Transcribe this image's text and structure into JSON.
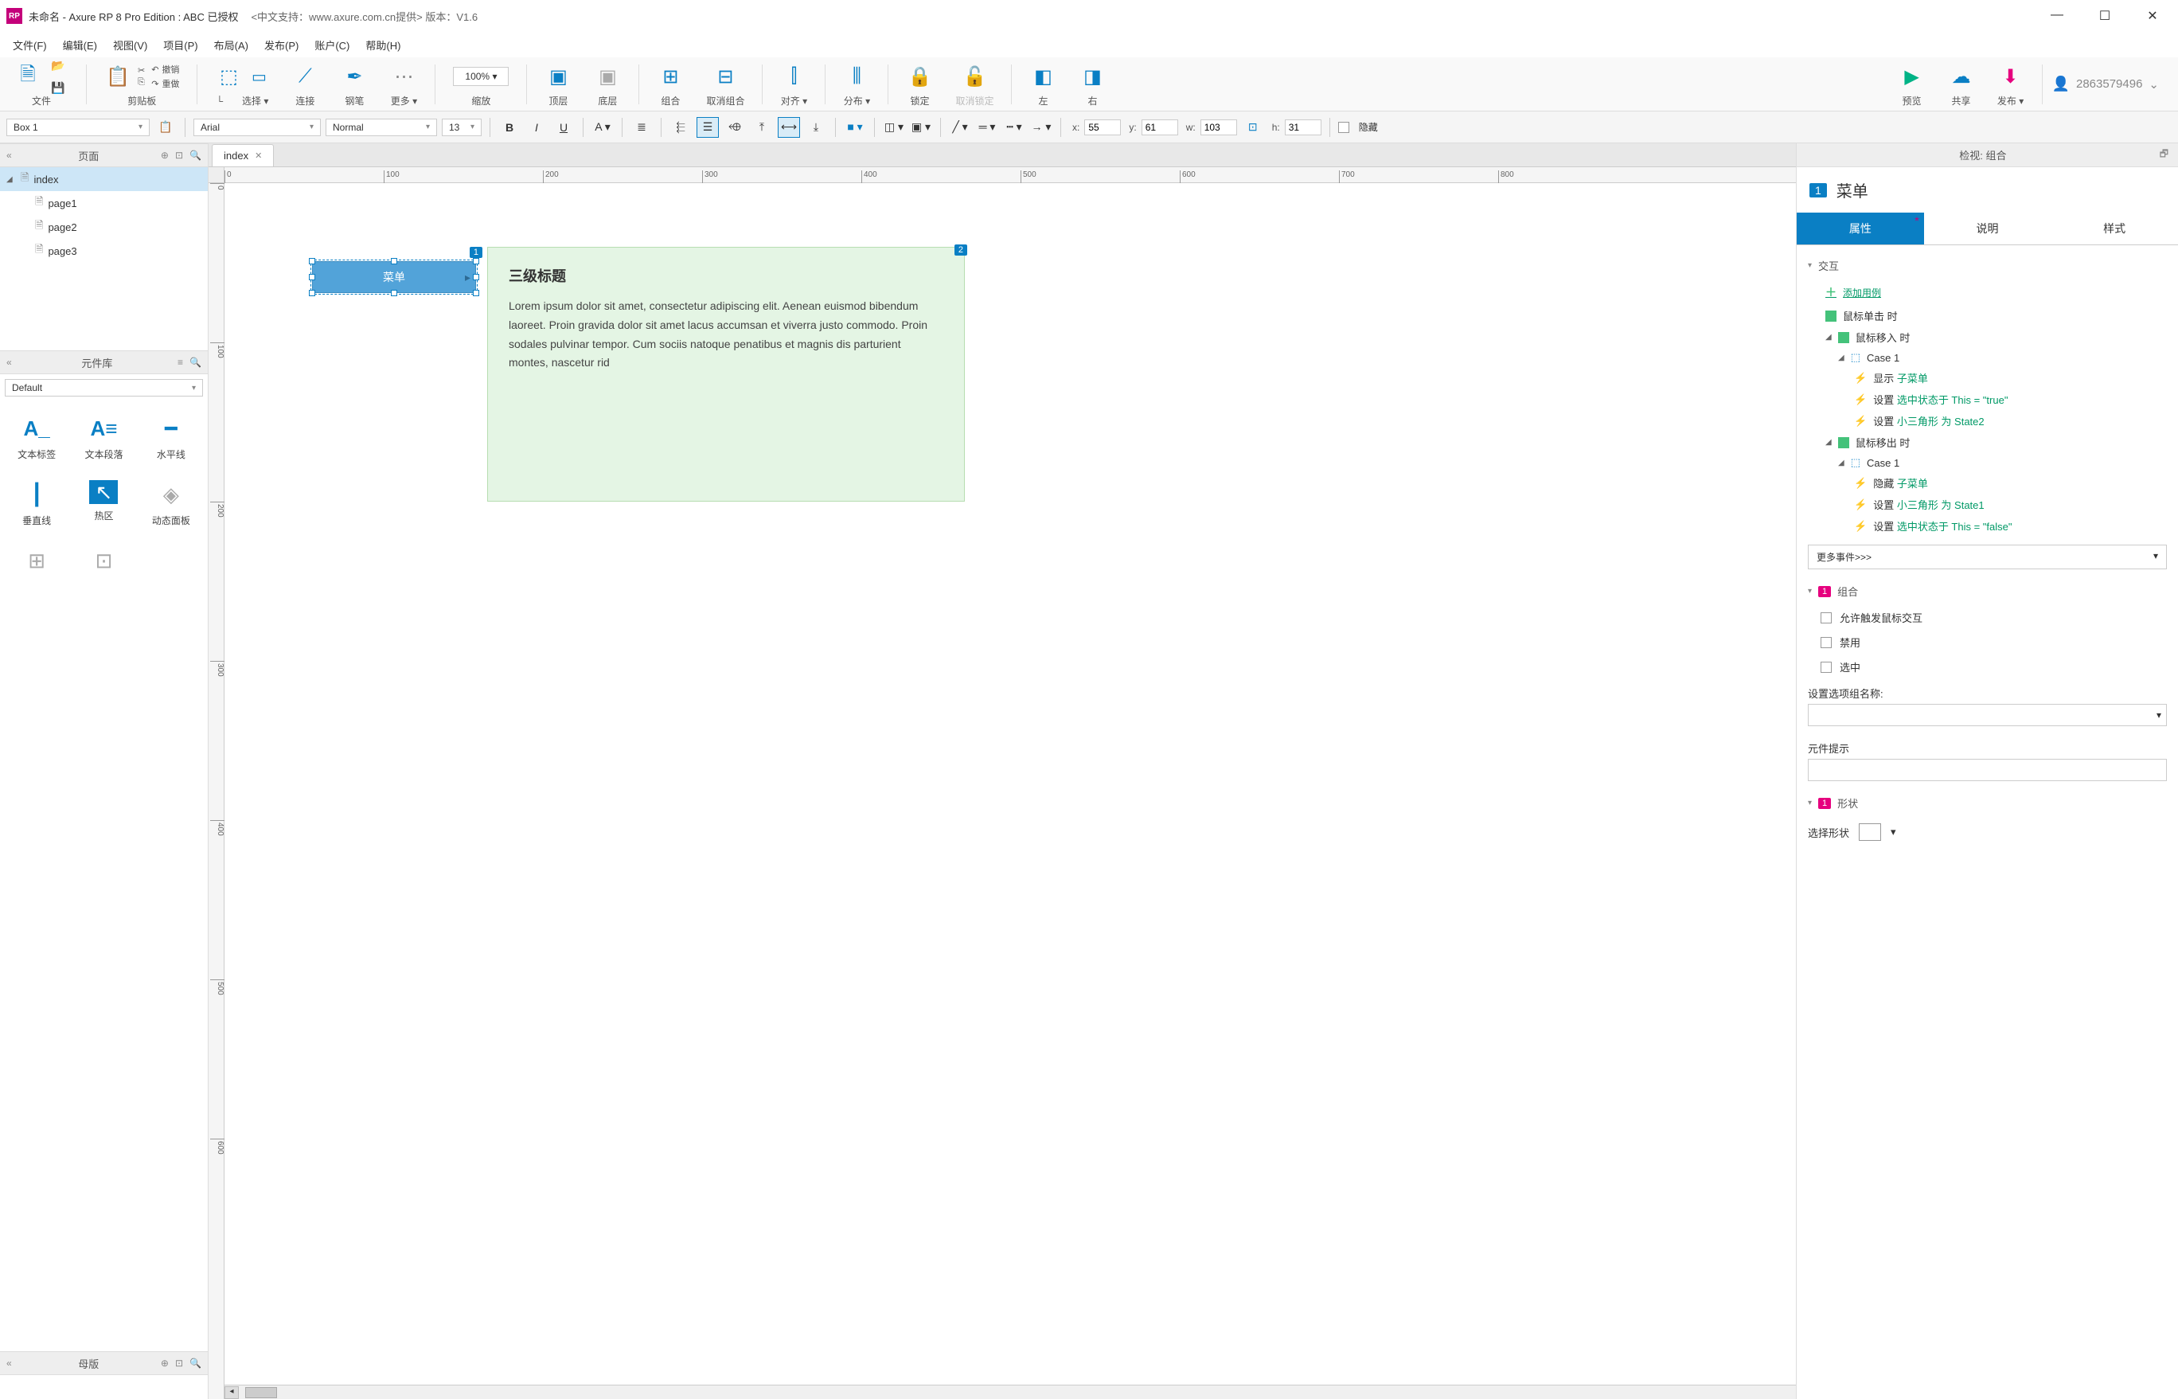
{
  "titlebar": {
    "title": "未命名 - Axure RP 8 Pro Edition : ABC 已授权",
    "subtitle": "<中文支持：www.axure.com.cn提供> 版本：V1.6"
  },
  "menubar": [
    "文件(F)",
    "编辑(E)",
    "视图(V)",
    "项目(P)",
    "布局(A)",
    "发布(P)",
    "账户(C)",
    "帮助(H)"
  ],
  "toolbar1": {
    "file": "文件",
    "clipboard": "剪贴板",
    "undo": "撤销",
    "redo": "重做",
    "select": "选择",
    "connect": "连接",
    "pen": "钢笔",
    "more": "更多",
    "zoom_value": "100%",
    "zoom_label": "缩放",
    "front": "顶层",
    "back": "底层",
    "group": "组合",
    "ungroup": "取消组合",
    "align": "对齐",
    "distribute": "分布",
    "lock": "锁定",
    "unlock": "取消锁定",
    "left": "左",
    "right": "右",
    "preview": "预览",
    "share": "共享",
    "publish": "发布",
    "user": "2863579496"
  },
  "toolbar2": {
    "widget_name": "Box 1",
    "font": "Arial",
    "weight": "Normal",
    "size": "13",
    "x": "55",
    "y": "61",
    "w": "103",
    "h": "31",
    "hidden": "隐藏"
  },
  "pages": {
    "title": "页面",
    "items": [
      {
        "name": "index",
        "selected": true,
        "expandable": true
      },
      {
        "name": "page1"
      },
      {
        "name": "page2"
      },
      {
        "name": "page3"
      }
    ]
  },
  "library": {
    "title": "元件库",
    "set": "Default",
    "items": [
      {
        "name": "文本标签"
      },
      {
        "name": "文本段落"
      },
      {
        "name": "水平线"
      },
      {
        "name": "垂直线"
      },
      {
        "name": "热区"
      },
      {
        "name": "动态面板"
      }
    ]
  },
  "masters": {
    "title": "母版"
  },
  "tabs": [
    {
      "name": "index"
    }
  ],
  "ruler_h": [
    "0",
    "100",
    "200",
    "300",
    "400",
    "500",
    "600",
    "700",
    "800"
  ],
  "ruler_v": [
    "0",
    "100",
    "200",
    "300",
    "400",
    "500",
    "600"
  ],
  "canvas": {
    "menu_label": "菜单",
    "badge1": "1",
    "badge2": "2",
    "note_title": "三级标题",
    "note_body": "Lorem ipsum dolor sit amet, consectetur adipiscing elit. Aenean euismod bibendum laoreet. Proin gravida dolor sit amet lacus accumsan et viverra justo commodo. Proin sodales pulvinar tempor. Cum sociis natoque penatibus et magnis dis parturient montes, nascetur rid"
  },
  "inspector": {
    "header": "检视: 组合",
    "num": "1",
    "name": "菜单",
    "tabs": [
      "属性",
      "说明",
      "样式"
    ],
    "section_ix": "交互",
    "add_case": "添加用例",
    "events": {
      "click": "鼠标单击 时",
      "mousein": "鼠标移入 时",
      "case1": "Case 1",
      "a1_pre": "显示 ",
      "a1_grn": "子菜单",
      "a2_pre": "设置 ",
      "a2_grn": "选中状态于 This = \"true\"",
      "a3_pre": "设置 ",
      "a3_grn": "小三角形 为 State2",
      "mouseout": "鼠标移出 时",
      "case2": "Case 1",
      "b1_pre": "隐藏 ",
      "b1_grn": "子菜单",
      "b2_pre": "设置 ",
      "b2_grn": "小三角形 为 State1",
      "b3_pre": "设置 ",
      "b3_grn": "选中状态于 This = \"false\""
    },
    "more_events": "更多事件>>>",
    "section_group": "组合",
    "chk1": "允许触发鼠标交互",
    "chk2": "禁用",
    "chk3": "选中",
    "opt_group_label": "设置选项组名称:",
    "tooltip_label": "元件提示",
    "section_shape": "形状",
    "shape_select": "选择形状"
  }
}
